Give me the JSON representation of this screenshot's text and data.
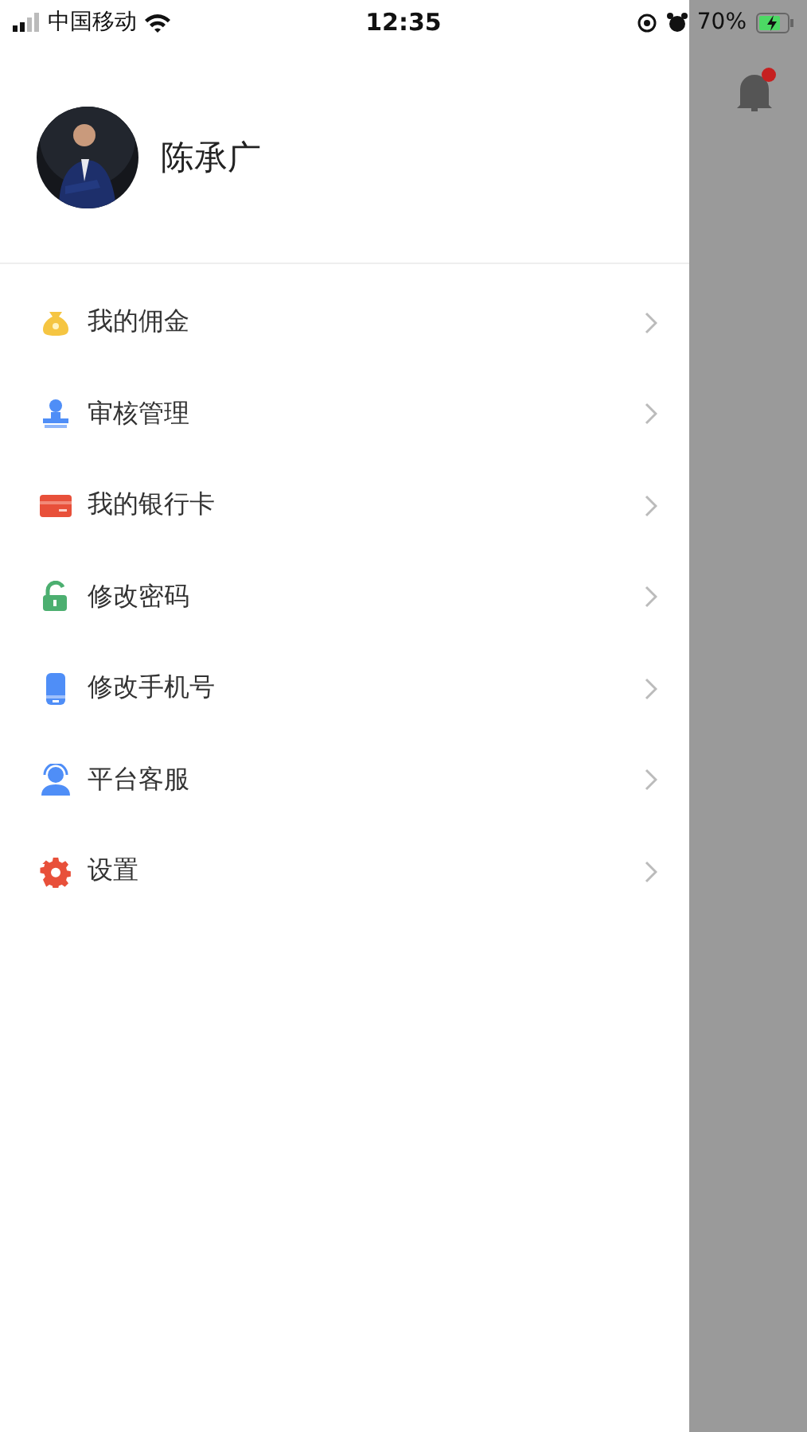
{
  "status_bar": {
    "carrier": "中国移动",
    "time": "12:35",
    "battery": "70%"
  },
  "profile": {
    "name": "陈承广"
  },
  "menu": [
    {
      "kind": "moneybag",
      "label": "我的佣金"
    },
    {
      "kind": "stamp",
      "label": "审核管理"
    },
    {
      "kind": "card",
      "label": "我的银行卡"
    },
    {
      "kind": "lock",
      "label": "修改密码"
    },
    {
      "kind": "phone",
      "label": "修改手机号"
    },
    {
      "kind": "agent",
      "label": "平台客服"
    },
    {
      "kind": "gear",
      "label": "设置"
    }
  ],
  "notifications": {
    "unread": true
  }
}
